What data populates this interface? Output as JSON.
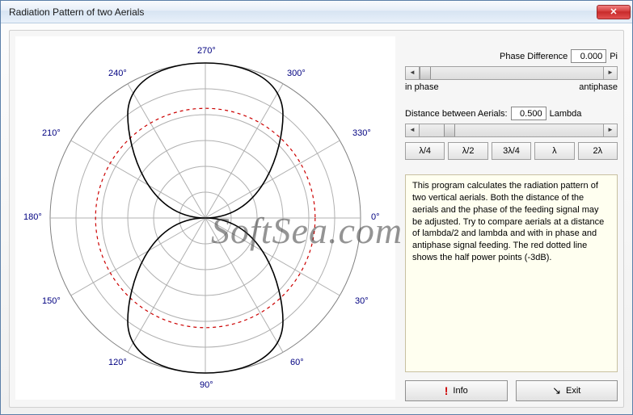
{
  "window": {
    "title": "Radiation Pattern of two Aerials"
  },
  "controls": {
    "phase": {
      "label": "Phase Difference",
      "value": "0.000",
      "unit": "Pi",
      "minLabel": "in phase",
      "maxLabel": "antiphase",
      "thumbPos": 0
    },
    "distance": {
      "label": "Distance between Aerials:",
      "value": "0.500",
      "unit": "Lambda",
      "thumbPos": 13
    },
    "presets": [
      "λ/4",
      "λ/2",
      "3λ/4",
      "λ",
      "2λ"
    ]
  },
  "info": {
    "text": "This program calculates the radiation pattern of two vertical aerials. Both the distance of the aerials and the phase of the feeding signal may be adjusted. Try to compare aerials at a distance of lambda/2 and lambda and with in phase and antiphase signal feeding. The red dotted line shows the half power points (-3dB)."
  },
  "buttons": {
    "info": "Info",
    "exit": "Exit"
  },
  "watermark": "SoftSea.com",
  "chart_data": {
    "type": "polar",
    "title": "",
    "angle_labels_deg": [
      0,
      30,
      60,
      90,
      120,
      150,
      180,
      210,
      240,
      270,
      300,
      330
    ],
    "radial_rings": 6,
    "series": [
      {
        "name": "pattern",
        "style": "solid-black",
        "formula": "|cos(theta - 90deg)|",
        "note": "figure-eight with lobes at 90° and 270°, nulls at 0° and 180°"
      },
      {
        "name": "half-power",
        "style": "dashed-red",
        "formula": "0.707 constant circle",
        "note": "-3dB circle"
      }
    ],
    "r_range": [
      0,
      1
    ]
  }
}
